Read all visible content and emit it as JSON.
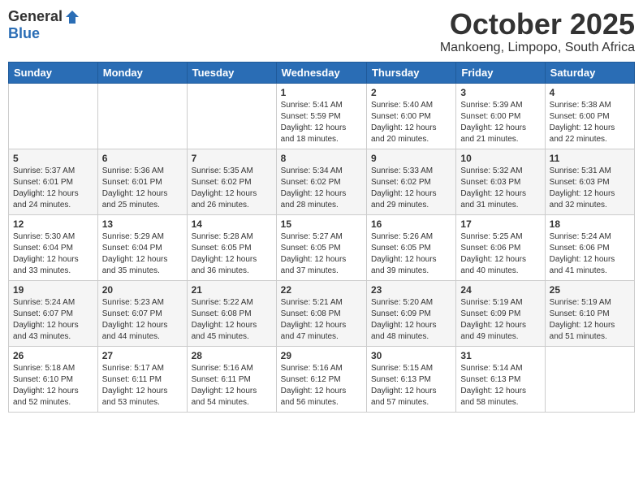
{
  "logo": {
    "general": "General",
    "blue": "Blue"
  },
  "header": {
    "month": "October 2025",
    "location": "Mankoeng, Limpopo, South Africa"
  },
  "weekdays": [
    "Sunday",
    "Monday",
    "Tuesday",
    "Wednesday",
    "Thursday",
    "Friday",
    "Saturday"
  ],
  "rows": [
    [
      {
        "day": "",
        "info": ""
      },
      {
        "day": "",
        "info": ""
      },
      {
        "day": "",
        "info": ""
      },
      {
        "day": "1",
        "info": "Sunrise: 5:41 AM\nSunset: 5:59 PM\nDaylight: 12 hours\nand 18 minutes."
      },
      {
        "day": "2",
        "info": "Sunrise: 5:40 AM\nSunset: 6:00 PM\nDaylight: 12 hours\nand 20 minutes."
      },
      {
        "day": "3",
        "info": "Sunrise: 5:39 AM\nSunset: 6:00 PM\nDaylight: 12 hours\nand 21 minutes."
      },
      {
        "day": "4",
        "info": "Sunrise: 5:38 AM\nSunset: 6:00 PM\nDaylight: 12 hours\nand 22 minutes."
      }
    ],
    [
      {
        "day": "5",
        "info": "Sunrise: 5:37 AM\nSunset: 6:01 PM\nDaylight: 12 hours\nand 24 minutes."
      },
      {
        "day": "6",
        "info": "Sunrise: 5:36 AM\nSunset: 6:01 PM\nDaylight: 12 hours\nand 25 minutes."
      },
      {
        "day": "7",
        "info": "Sunrise: 5:35 AM\nSunset: 6:02 PM\nDaylight: 12 hours\nand 26 minutes."
      },
      {
        "day": "8",
        "info": "Sunrise: 5:34 AM\nSunset: 6:02 PM\nDaylight: 12 hours\nand 28 minutes."
      },
      {
        "day": "9",
        "info": "Sunrise: 5:33 AM\nSunset: 6:02 PM\nDaylight: 12 hours\nand 29 minutes."
      },
      {
        "day": "10",
        "info": "Sunrise: 5:32 AM\nSunset: 6:03 PM\nDaylight: 12 hours\nand 31 minutes."
      },
      {
        "day": "11",
        "info": "Sunrise: 5:31 AM\nSunset: 6:03 PM\nDaylight: 12 hours\nand 32 minutes."
      }
    ],
    [
      {
        "day": "12",
        "info": "Sunrise: 5:30 AM\nSunset: 6:04 PM\nDaylight: 12 hours\nand 33 minutes."
      },
      {
        "day": "13",
        "info": "Sunrise: 5:29 AM\nSunset: 6:04 PM\nDaylight: 12 hours\nand 35 minutes."
      },
      {
        "day": "14",
        "info": "Sunrise: 5:28 AM\nSunset: 6:05 PM\nDaylight: 12 hours\nand 36 minutes."
      },
      {
        "day": "15",
        "info": "Sunrise: 5:27 AM\nSunset: 6:05 PM\nDaylight: 12 hours\nand 37 minutes."
      },
      {
        "day": "16",
        "info": "Sunrise: 5:26 AM\nSunset: 6:05 PM\nDaylight: 12 hours\nand 39 minutes."
      },
      {
        "day": "17",
        "info": "Sunrise: 5:25 AM\nSunset: 6:06 PM\nDaylight: 12 hours\nand 40 minutes."
      },
      {
        "day": "18",
        "info": "Sunrise: 5:24 AM\nSunset: 6:06 PM\nDaylight: 12 hours\nand 41 minutes."
      }
    ],
    [
      {
        "day": "19",
        "info": "Sunrise: 5:24 AM\nSunset: 6:07 PM\nDaylight: 12 hours\nand 43 minutes."
      },
      {
        "day": "20",
        "info": "Sunrise: 5:23 AM\nSunset: 6:07 PM\nDaylight: 12 hours\nand 44 minutes."
      },
      {
        "day": "21",
        "info": "Sunrise: 5:22 AM\nSunset: 6:08 PM\nDaylight: 12 hours\nand 45 minutes."
      },
      {
        "day": "22",
        "info": "Sunrise: 5:21 AM\nSunset: 6:08 PM\nDaylight: 12 hours\nand 47 minutes."
      },
      {
        "day": "23",
        "info": "Sunrise: 5:20 AM\nSunset: 6:09 PM\nDaylight: 12 hours\nand 48 minutes."
      },
      {
        "day": "24",
        "info": "Sunrise: 5:19 AM\nSunset: 6:09 PM\nDaylight: 12 hours\nand 49 minutes."
      },
      {
        "day": "25",
        "info": "Sunrise: 5:19 AM\nSunset: 6:10 PM\nDaylight: 12 hours\nand 51 minutes."
      }
    ],
    [
      {
        "day": "26",
        "info": "Sunrise: 5:18 AM\nSunset: 6:10 PM\nDaylight: 12 hours\nand 52 minutes."
      },
      {
        "day": "27",
        "info": "Sunrise: 5:17 AM\nSunset: 6:11 PM\nDaylight: 12 hours\nand 53 minutes."
      },
      {
        "day": "28",
        "info": "Sunrise: 5:16 AM\nSunset: 6:11 PM\nDaylight: 12 hours\nand 54 minutes."
      },
      {
        "day": "29",
        "info": "Sunrise: 5:16 AM\nSunset: 6:12 PM\nDaylight: 12 hours\nand 56 minutes."
      },
      {
        "day": "30",
        "info": "Sunrise: 5:15 AM\nSunset: 6:13 PM\nDaylight: 12 hours\nand 57 minutes."
      },
      {
        "day": "31",
        "info": "Sunrise: 5:14 AM\nSunset: 6:13 PM\nDaylight: 12 hours\nand 58 minutes."
      },
      {
        "day": "",
        "info": ""
      }
    ]
  ]
}
